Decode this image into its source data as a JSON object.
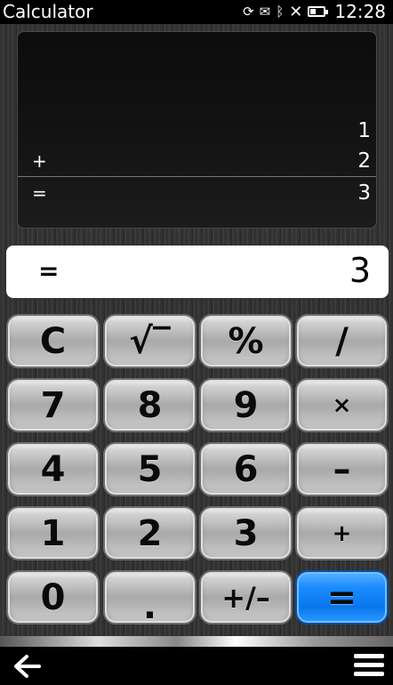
{
  "status_bar": {
    "app_title": "Calculator",
    "time": "12:28",
    "icons": [
      "sync-icon",
      "mail-icon",
      "bluetooth-icon",
      "no-signal-icon",
      "battery-icon"
    ],
    "battery_level": 0.4
  },
  "tape": {
    "rows": [
      {
        "op": "",
        "value": "1"
      },
      {
        "op": "+",
        "value": "2"
      },
      {
        "op": "=",
        "value": "3"
      }
    ]
  },
  "display": {
    "op": "=",
    "value": "3"
  },
  "keypad": {
    "keys": [
      "C",
      "√‾",
      "%",
      "/",
      "7",
      "8",
      "9",
      "×",
      "4",
      "5",
      "6",
      "–",
      "1",
      "2",
      "3",
      "+",
      "0",
      ".",
      "+/–",
      "="
    ]
  },
  "colors": {
    "equals_key": "#1a8cff",
    "display_bg": "#ffffff"
  },
  "toolbar": {
    "icons": [
      "back-arrow-icon",
      "menu-icon"
    ]
  }
}
